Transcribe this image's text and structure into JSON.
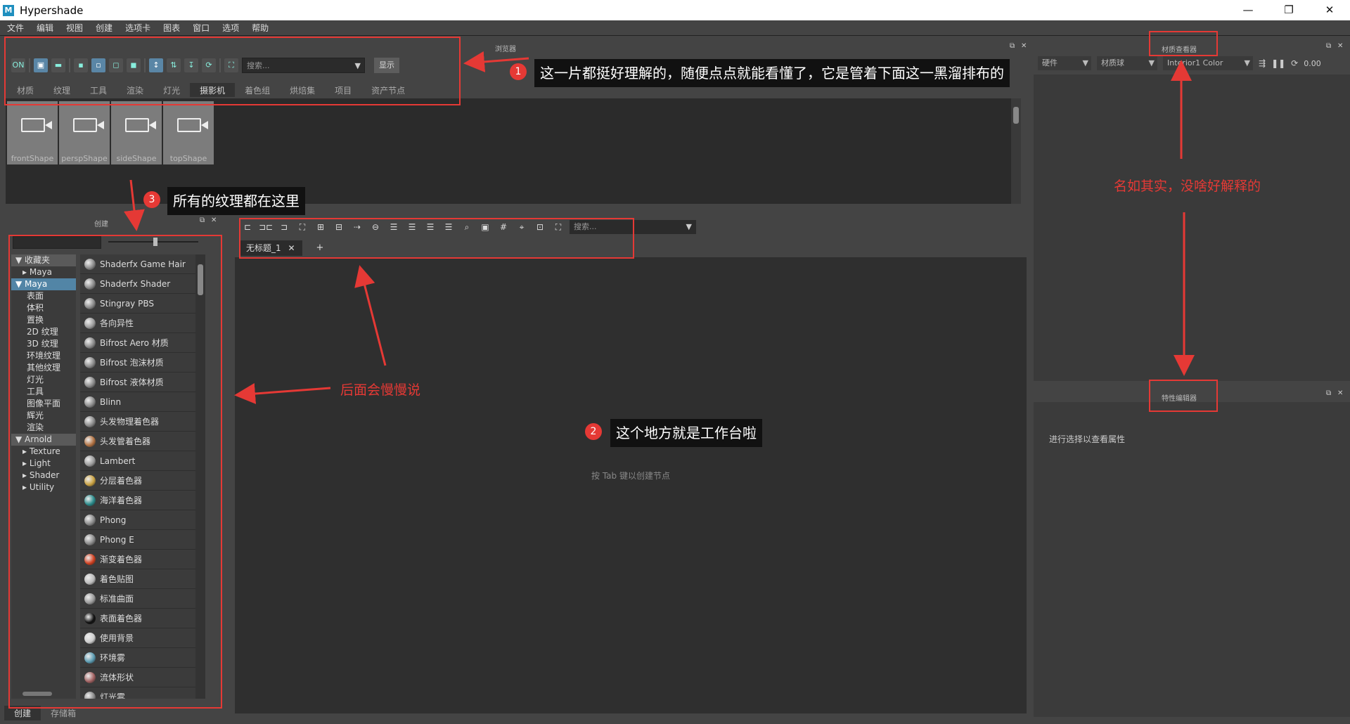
{
  "window": {
    "title": "Hypershade",
    "app_icon_letter": "M",
    "buttons": [
      "—",
      "❐",
      "✕"
    ]
  },
  "menu": [
    "文件",
    "编辑",
    "视图",
    "创建",
    "选项卡",
    "图表",
    "窗口",
    "选项",
    "帮助"
  ],
  "browser": {
    "title": "浏览器",
    "search_placeholder": "搜索...",
    "show_button": "显示",
    "tabs": [
      "材质",
      "纹理",
      "工具",
      "渲染",
      "灯光",
      "摄影机",
      "着色组",
      "烘焙集",
      "项目",
      "资产节点"
    ],
    "cameras": [
      "frontShape",
      "perspShape",
      "sideShape",
      "topShape"
    ]
  },
  "create_panel": {
    "title": "创建",
    "tree": [
      {
        "label": "收藏夹",
        "kind": "cat",
        "arrow": "▼"
      },
      {
        "label": "Maya",
        "kind": "child",
        "arrow": "▸"
      },
      {
        "label": "Maya",
        "kind": "sel",
        "arrow": "▼"
      },
      {
        "label": "表面",
        "kind": "sub"
      },
      {
        "label": "体积",
        "kind": "sub"
      },
      {
        "label": "置换",
        "kind": "sub"
      },
      {
        "label": "2D 纹理",
        "kind": "sub"
      },
      {
        "label": "3D 纹理",
        "kind": "sub"
      },
      {
        "label": "环境纹理",
        "kind": "sub"
      },
      {
        "label": "其他纹理",
        "kind": "sub"
      },
      {
        "label": "灯光",
        "kind": "sub"
      },
      {
        "label": "工具",
        "kind": "sub"
      },
      {
        "label": "图像平面",
        "kind": "sub"
      },
      {
        "label": "辉光",
        "kind": "sub"
      },
      {
        "label": "渲染",
        "kind": "sub"
      },
      {
        "label": "Arnold",
        "kind": "cat",
        "arrow": "▼"
      },
      {
        "label": "Texture",
        "kind": "child",
        "arrow": "▸"
      },
      {
        "label": "Light",
        "kind": "child",
        "arrow": "▸"
      },
      {
        "label": "Shader",
        "kind": "child",
        "arrow": "▸"
      },
      {
        "label": "Utility",
        "kind": "child",
        "arrow": "▸"
      }
    ],
    "nodes": [
      {
        "label": "Shaderfx Game Hair",
        "swatch": "#888"
      },
      {
        "label": "Shaderfx Shader",
        "swatch": "#888"
      },
      {
        "label": "Stingray PBS",
        "swatch": "#888"
      },
      {
        "label": "各向异性",
        "swatch": "#999"
      },
      {
        "label": "Bifrost Aero 材质",
        "swatch": "#888"
      },
      {
        "label": "Bifrost 泡沫材质",
        "swatch": "#888"
      },
      {
        "label": "Bifrost 液体材质",
        "swatch": "#888"
      },
      {
        "label": "Blinn",
        "swatch": "#888"
      },
      {
        "label": "头发物理着色器",
        "swatch": "#888"
      },
      {
        "label": "头发管着色器",
        "swatch": "#b07040"
      },
      {
        "label": "Lambert",
        "swatch": "#999"
      },
      {
        "label": "分层着色器",
        "swatch": "#c8a040"
      },
      {
        "label": "海洋着色器",
        "swatch": "#2a8a8a"
      },
      {
        "label": "Phong",
        "swatch": "#888"
      },
      {
        "label": "Phong E",
        "swatch": "#888"
      },
      {
        "label": "渐变着色器",
        "swatch": "#d04020"
      },
      {
        "label": "着色贴图",
        "swatch": "#bbb"
      },
      {
        "label": "标准曲面",
        "swatch": "#999"
      },
      {
        "label": "表面着色器",
        "swatch": "#111"
      },
      {
        "label": "使用背景",
        "swatch": "#ccc"
      },
      {
        "label": "环境雾",
        "swatch": "#5a9ab0"
      },
      {
        "label": "流体形状",
        "swatch": "#a06060"
      },
      {
        "label": "灯光雾",
        "swatch": "#888"
      }
    ],
    "bottom_tabs": [
      "创建",
      "存储箱"
    ]
  },
  "workspace": {
    "search_placeholder": "搜索...",
    "tab_label": "无标题_1",
    "tab_close": "✕",
    "add_tab": "+",
    "hint": "按 Tab 键以创建节点"
  },
  "material_viewer": {
    "title": "材质查看器",
    "renderer": "硬件",
    "shape": "材质球",
    "env": "Interior1 Color",
    "value": "0.00"
  },
  "attribute_editor": {
    "title": "特性编辑器",
    "message": "进行选择以查看属性"
  },
  "annotations": {
    "note1_num": "1",
    "note1": "这一片都挺好理解的，随便点点就能看懂了，它是管着下面这一黑溜排布的",
    "note2_num": "2",
    "note2": "这个地方就是工作台啦",
    "note3_num": "3",
    "note3": "所有的纹理都在这里",
    "later": "后面会慢慢说",
    "self_explanatory": "名如其实，没啥好解释的"
  },
  "colors": {
    "accent_red": "#e53935",
    "selection_blue": "#5285a6"
  }
}
